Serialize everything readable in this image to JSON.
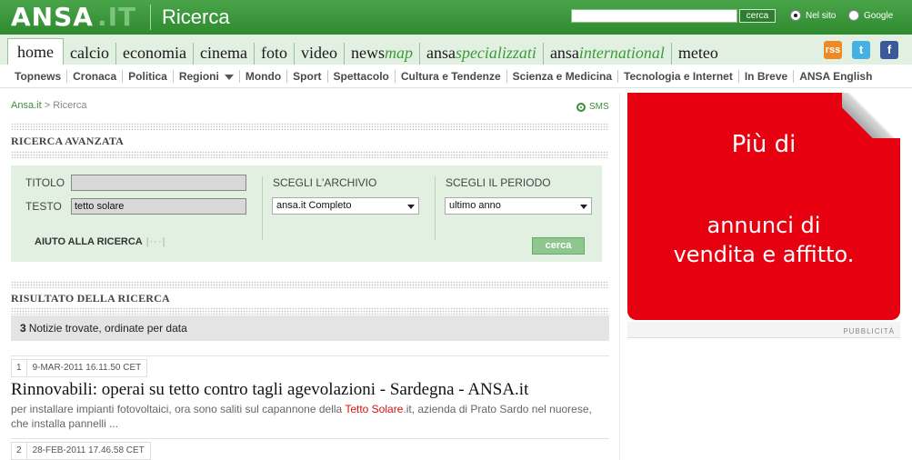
{
  "header": {
    "logo_text": "ANSA",
    "logo_suffix": ".IT",
    "page_title": "Ricerca",
    "search_value": "",
    "search_button": "cerca",
    "radio_site": "Nel sito",
    "radio_google": "Google"
  },
  "nav": {
    "sections": [
      {
        "label": "home",
        "suffix": ""
      },
      {
        "label": "calcio",
        "suffix": ""
      },
      {
        "label": "economia",
        "suffix": ""
      },
      {
        "label": "cinema",
        "suffix": ""
      },
      {
        "label": "foto",
        "suffix": ""
      },
      {
        "label": "video",
        "suffix": ""
      },
      {
        "label": "news",
        "suffix": "map"
      },
      {
        "label": "ansa",
        "suffix": "specializzati"
      },
      {
        "label": "ansa",
        "suffix": "international"
      },
      {
        "label": "meteo",
        "suffix": ""
      }
    ],
    "social": {
      "rss": "rss",
      "twitter": "t",
      "facebook": "f"
    },
    "topics": [
      "Topnews",
      "Cronaca",
      "Politica",
      "Regioni",
      "Mondo",
      "Sport",
      "Spettacolo",
      "Cultura e Tendenze",
      "Scienza e Medicina",
      "Tecnologia e Internet",
      "In Breve",
      "ANSA English"
    ]
  },
  "breadcrumb": {
    "home": "Ansa.it",
    "separator": " > ",
    "current": "Ricerca"
  },
  "sms_label": "SMS",
  "advanced": {
    "title": "RICERCA AVANZATA",
    "titolo_label": "TITOLO",
    "titolo_value": "",
    "testo_label": "TESTO",
    "testo_value": "tetto solare",
    "archive_label": "SCEGLI L'ARCHIVIO",
    "archive_value": "ansa.it Completo",
    "period_label": "SCEGLI IL PERIODO",
    "period_value": "ultimo anno",
    "help_label": "AIUTO ALLA RICERCA",
    "help_extra": "|···|",
    "submit_label": "cerca"
  },
  "results": {
    "title": "RISULTATO DELLA RICERCA",
    "count": "3",
    "count_text": "Notizie trovate, ordinate per data",
    "items": [
      {
        "num": "1",
        "date": "9-MAR-2011 16.11.50 CET",
        "title": "Rinnovabili: operai su tetto contro tagli agevolazioni - Sardegna - ANSA.it",
        "snippet_before": "per installare impianti fotovoltaici, ora sono saliti sul capannone della ",
        "snippet_highlight": "Tetto Solare",
        "snippet_after": ".it, azienda di Prato Sardo nel nuorese, che installa pannelli ..."
      },
      {
        "num": "2",
        "date": "28-FEB-2011 17.46.58 CET"
      }
    ]
  },
  "ad": {
    "line1": "Più di",
    "line2": "annunci di",
    "line3": "vendita e affitto.",
    "label": "PUBBLICITÀ",
    "colors": {
      "background": "#e60010"
    }
  },
  "colors": {
    "brand_green": "#2f8a2f",
    "highlight_red": "#d41111",
    "light_green": "#e2f0e2"
  }
}
